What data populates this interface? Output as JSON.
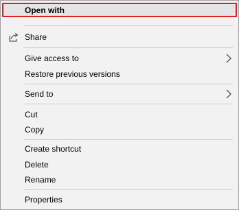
{
  "menu": {
    "open_with": "Open with",
    "share": "Share",
    "give_access_to": "Give access to",
    "restore_previous_versions": "Restore previous versions",
    "send_to": "Send to",
    "cut": "Cut",
    "copy": "Copy",
    "create_shortcut": "Create shortcut",
    "delete": "Delete",
    "rename": "Rename",
    "properties": "Properties"
  },
  "icons": {
    "share": "share-icon",
    "submenu": "chevron-right-icon"
  },
  "colors": {
    "menu_background": "#f2f2f2",
    "highlight_background": "#e5e5e5",
    "highlight_outline": "#e02020",
    "separator": "#cfcfcf"
  }
}
